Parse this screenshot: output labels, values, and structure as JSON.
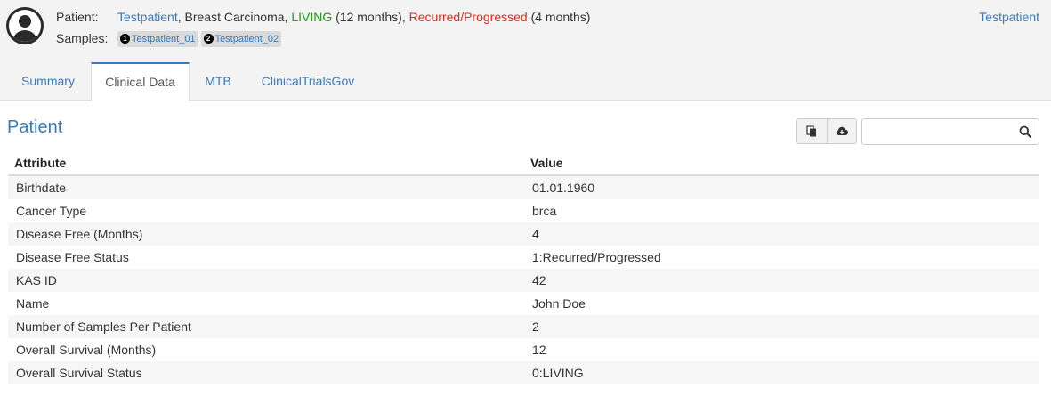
{
  "header": {
    "patient_label": "Patient:",
    "patient_name": "Testpatient",
    "cancer_type": "Breast Carcinoma",
    "survival_status": "LIVING",
    "survival_months": "(12 months)",
    "progress_status": "Recurred/Progressed",
    "progress_months": "(4 months)",
    "samples_label": "Samples:",
    "samples": [
      {
        "num": "1",
        "id": "Testpatient_01"
      },
      {
        "num": "2",
        "id": "Testpatient_02"
      }
    ],
    "top_right_link": "Testpatient"
  },
  "tabs": [
    "Summary",
    "Clinical Data",
    "MTB",
    "ClinicalTrialsGov"
  ],
  "active_tab": "Clinical Data",
  "section": {
    "title": "Patient"
  },
  "toolbar": {
    "copy_icon": "copy-icon",
    "download_icon": "cloud-download-icon",
    "search_icon": "search-icon",
    "search_value": ""
  },
  "table": {
    "columns": [
      "Attribute",
      "Value"
    ],
    "rows": [
      [
        "Birthdate",
        "01.01.1960"
      ],
      [
        "Cancer Type",
        "brca"
      ],
      [
        "Disease Free (Months)",
        "4"
      ],
      [
        "Disease Free Status",
        "1:Recurred/Progressed"
      ],
      [
        "KAS ID",
        "42"
      ],
      [
        "Name",
        "John Doe"
      ],
      [
        "Number of Samples Per Patient",
        "2"
      ],
      [
        "Overall Survival (Months)",
        "12"
      ],
      [
        "Overall Survival Status",
        "0:LIVING"
      ]
    ]
  },
  "colors": {
    "link": "#3b7ab8",
    "living": "#1d9a12",
    "progressed": "#e0291d"
  }
}
